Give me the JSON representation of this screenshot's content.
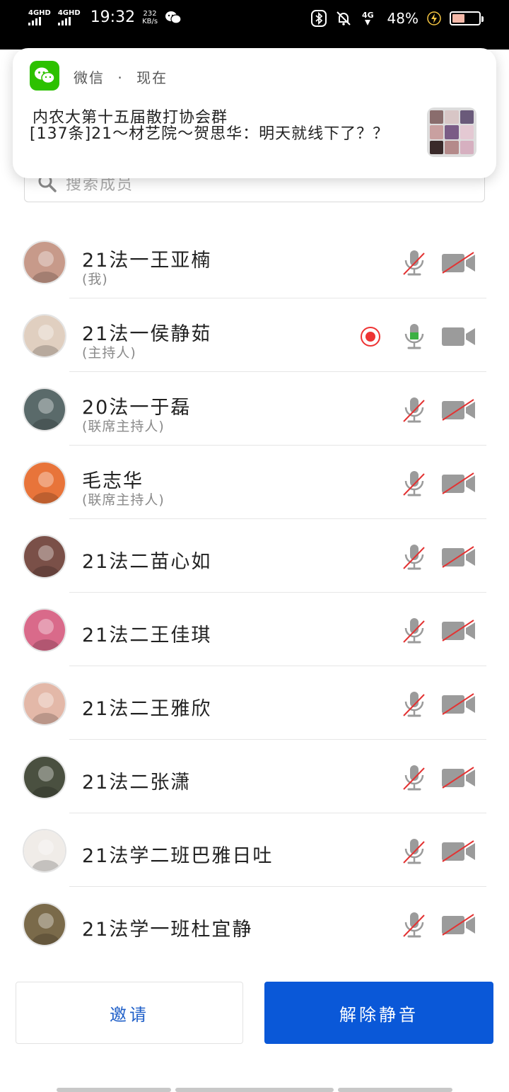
{
  "status_bar": {
    "net1": "4GHD",
    "net2": "4GHD",
    "time": "19:32",
    "speed_value": "232",
    "speed_unit": "KB/s",
    "net_type": "4G",
    "battery_percent": "48%",
    "battery_level": 0.48
  },
  "notification": {
    "app": "微信",
    "separator": "·",
    "when": "现在",
    "title": "内农大第十五届散打协会群",
    "body": "[137条]21～材艺院～贺思华：明天就线下了？？",
    "thumb_colors": [
      "#8a6d6d",
      "#d8c6c6",
      "#6a5a7a",
      "#c9a0a0",
      "#7a5c86",
      "#e4c9d3",
      "#3a2a2a",
      "#b48a8a",
      "#d6b0c0"
    ]
  },
  "search": {
    "placeholder": "搜索成员"
  },
  "members": [
    {
      "name": "21法一王亚楠",
      "role": "(我)",
      "mic": "muted",
      "cam": "off",
      "rec": false,
      "avatar_color": "#c79a8a"
    },
    {
      "name": "21法一侯静茹",
      "role": "(主持人)",
      "mic": "on",
      "cam": "on",
      "rec": true,
      "avatar_color": "#e0cfc0"
    },
    {
      "name": "20法一于磊",
      "role": "(联席主持人)",
      "mic": "muted",
      "cam": "off",
      "rec": false,
      "avatar_color": "#5a6a6a"
    },
    {
      "name": "毛志华",
      "role": "(联席主持人)",
      "mic": "muted",
      "cam": "off",
      "rec": false,
      "avatar_color": "#e8743a"
    },
    {
      "name": "21法二苗心如",
      "role": "",
      "mic": "muted",
      "cam": "off",
      "rec": false,
      "avatar_color": "#7a5048"
    },
    {
      "name": "21法二王佳琪",
      "role": "",
      "mic": "muted",
      "cam": "off",
      "rec": false,
      "avatar_color": "#d96a8a"
    },
    {
      "name": "21法二王雅欣",
      "role": "",
      "mic": "muted",
      "cam": "off",
      "rec": false,
      "avatar_color": "#e3b8a8"
    },
    {
      "name": "21法二张潇",
      "role": "",
      "mic": "muted",
      "cam": "off",
      "rec": false,
      "avatar_color": "#4a5040"
    },
    {
      "name": "21法学二班巴雅日吐",
      "role": "",
      "mic": "muted",
      "cam": "off",
      "rec": false,
      "avatar_color": "#f0ece8"
    },
    {
      "name": "21法学一班杜宜静",
      "role": "",
      "mic": "muted",
      "cam": "off",
      "rec": false,
      "avatar_color": "#7a6a4a"
    }
  ],
  "actions": {
    "invite": "邀请",
    "unmute": "解除静音"
  },
  "colors": {
    "primary": "#0a58d8",
    "wechat_green": "#2dc100",
    "record_red": "#e33333",
    "mic_on_green": "#3cb043",
    "icon_gray": "#9b9b9b"
  }
}
